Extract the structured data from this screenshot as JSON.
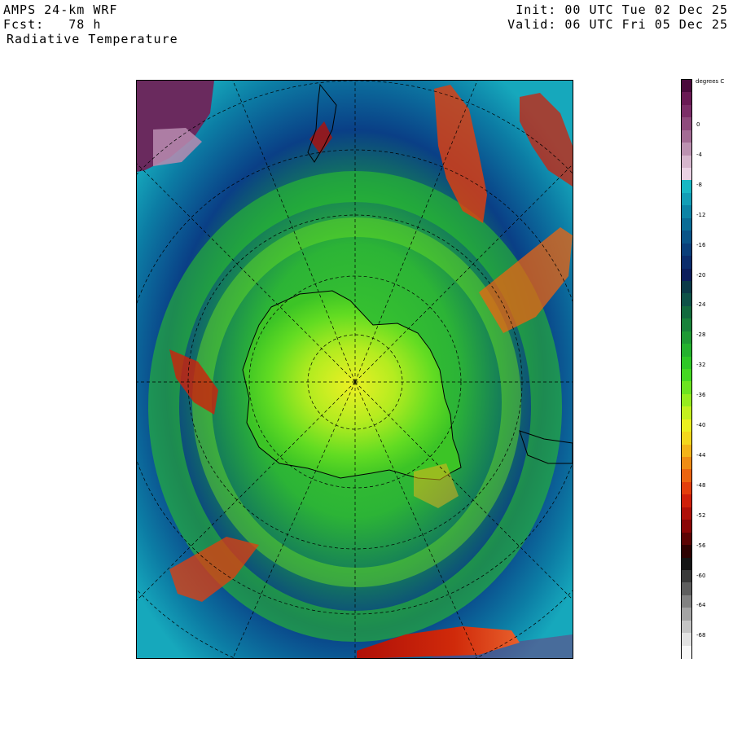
{
  "header": {
    "model": "AMPS 24-km WRF",
    "forecast": "Fcst:   78 h",
    "field": "Radiative Temperature",
    "init": "Init: 00 UTC Tue 02 Dec 25",
    "valid": "Valid: 06 UTC Fri 05 Dec 25"
  },
  "colorbar": {
    "units": "degrees C",
    "labels": [
      "0",
      "-4",
      "-8",
      "-12",
      "-16",
      "-20",
      "-24",
      "-28",
      "-32",
      "-36",
      "-40",
      "-44",
      "-48",
      "-52",
      "-56",
      "-60",
      "-64",
      "-68"
    ],
    "colors": [
      "#4a0a3c",
      "#6a1a55",
      "#7c2e68",
      "#8f4b7d",
      "#a36c94",
      "#bc92b1",
      "#d6b6cd",
      "#ead2e4",
      "#18b8c4",
      "#129eb6",
      "#0c84a6",
      "#0a6c96",
      "#0a5488",
      "#0a3f7a",
      "#0b2d6c",
      "#0c1e5c",
      "#0b3a48",
      "#0e5248",
      "#126a3e",
      "#18823a",
      "#1e9a34",
      "#24b22e",
      "#2ec826",
      "#44d822",
      "#6ce420",
      "#96ec1e",
      "#c4f01e",
      "#ecf01e",
      "#f4d81c",
      "#f4b418",
      "#f08c14",
      "#ec6410",
      "#e43e0c",
      "#d0200a",
      "#b01008",
      "#8a0606",
      "#5c0404",
      "#2e0202",
      "#141414",
      "#3a3a3a",
      "#5e5e5e",
      "#828282",
      "#a4a4a4",
      "#c4c4c4",
      "#e2e2e2",
      "#f8f8f8"
    ]
  }
}
